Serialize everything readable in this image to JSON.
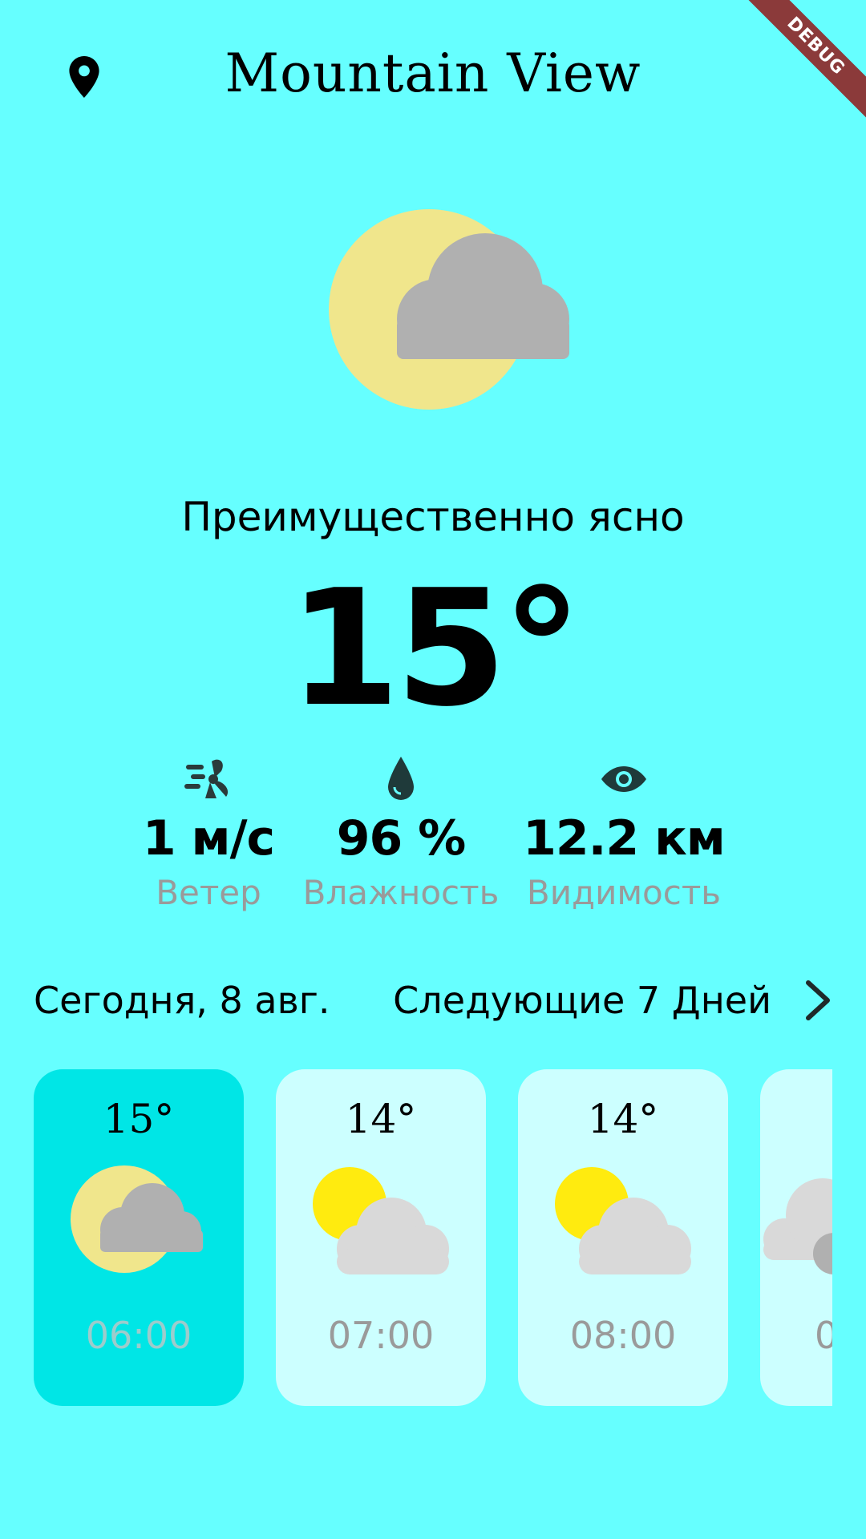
{
  "header": {
    "city": "Mountain View",
    "location_icon": "location-pin-icon",
    "debug_label": "DEBUG"
  },
  "current": {
    "icon": "partly-cloudy-night-icon",
    "condition": "Преимущественно ясно",
    "temperature": "15°"
  },
  "stats": [
    {
      "icon": "wind-icon",
      "value": "1 м/с",
      "label": "Ветер"
    },
    {
      "icon": "humidity-drop-icon",
      "value": "96 %",
      "label": "Влажность"
    },
    {
      "icon": "eye-icon",
      "value": "12.2 км",
      "label": "Видимость"
    }
  ],
  "forecast": {
    "today_label": "Сегодня, 8 авг.",
    "next_days_label": "Следующие 7 Дней",
    "next_icon": "chevron-right-icon"
  },
  "hourly": [
    {
      "temp": "15°",
      "time": "06:00",
      "icon": "partly-cloudy-night-icon",
      "active": true
    },
    {
      "temp": "14°",
      "time": "07:00",
      "icon": "partly-cloudy-day-icon",
      "active": false
    },
    {
      "temp": "14°",
      "time": "08:00",
      "icon": "partly-cloudy-day-icon",
      "active": false
    },
    {
      "temp": "",
      "time": "0",
      "icon": "cloudy-icon",
      "active": false
    }
  ],
  "colors": {
    "background": "#66ffff",
    "card": "#ccffff",
    "card_active": "#00e6e6",
    "secondary_text": "#9a9a9a",
    "moon": "#f0e68c",
    "sun": "#ffeb0f",
    "cloud_dark": "#b0b0b0",
    "cloud_light": "#d9d9d9"
  }
}
